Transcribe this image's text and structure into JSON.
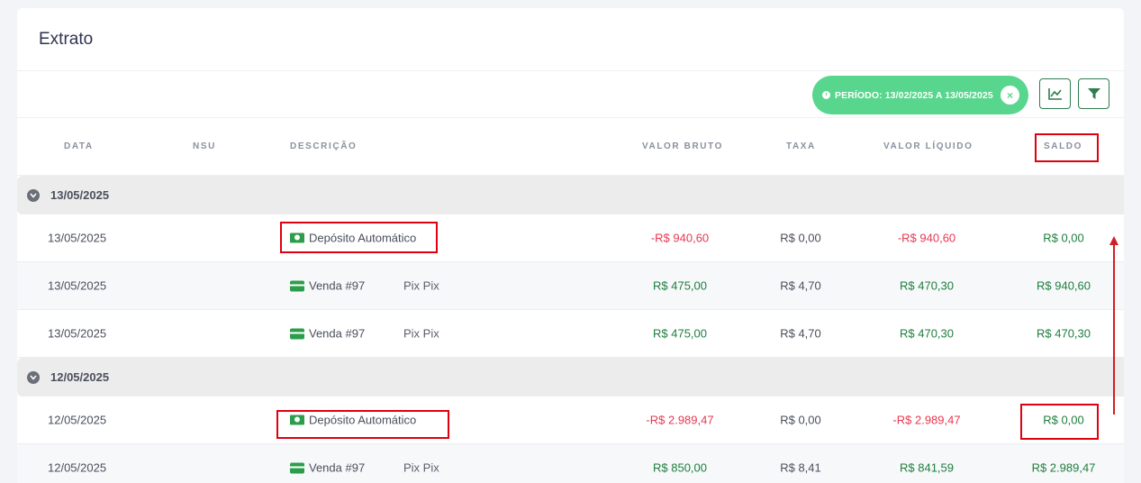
{
  "page": {
    "title": "Extrato"
  },
  "toolbar": {
    "period_label": "PERÍODO: 13/02/2025 A 13/05/2025",
    "period_close": "×",
    "accent_color": "#58d68d",
    "chart_button_icon": "line-chart-icon",
    "filter_button_icon": "filter-icon"
  },
  "columns": {
    "date": "DATA",
    "nsu": "NSU",
    "description": "DESCRIÇÃO",
    "gross": "VALOR BRUTO",
    "fee": "TAXA",
    "net": "VALOR LÍQUIDO",
    "balance": "SALDO"
  },
  "groups": [
    {
      "date": "13/05/2025",
      "rows": [
        {
          "date": "13/05/2025",
          "icon": "money-icon",
          "description": "Depósito Automático",
          "payment": "",
          "gross": "-R$ 940,60",
          "fee": "R$ 0,00",
          "net": "-R$ 940,60",
          "balance": "R$ 0,00"
        },
        {
          "date": "13/05/2025",
          "icon": "card-icon",
          "description": "Venda #97",
          "payment": "Pix Pix",
          "gross": "R$ 475,00",
          "fee": "R$ 4,70",
          "net": "R$ 470,30",
          "balance": "R$ 940,60"
        },
        {
          "date": "13/05/2025",
          "icon": "card-icon",
          "description": "Venda #97",
          "payment": "Pix Pix",
          "gross": "R$ 475,00",
          "fee": "R$ 4,70",
          "net": "R$ 470,30",
          "balance": "R$ 470,30"
        }
      ]
    },
    {
      "date": "12/05/2025",
      "rows": [
        {
          "date": "12/05/2025",
          "icon": "money-icon",
          "description": "Depósito Automático",
          "payment": "",
          "gross": "-R$ 2.989,47",
          "fee": "R$ 0,00",
          "net": "-R$ 2.989,47",
          "balance": "R$ 0,00"
        },
        {
          "date": "12/05/2025",
          "icon": "card-icon",
          "description": "Venda #97",
          "payment": "Pix Pix",
          "gross": "R$ 850,00",
          "fee": "R$ 8,41",
          "net": "R$ 841,59",
          "balance": "R$ 2.989,47"
        }
      ]
    }
  ],
  "colors": {
    "negative": "#e53950",
    "positive": "#1e7e3e",
    "highlight": "#e0000f"
  }
}
